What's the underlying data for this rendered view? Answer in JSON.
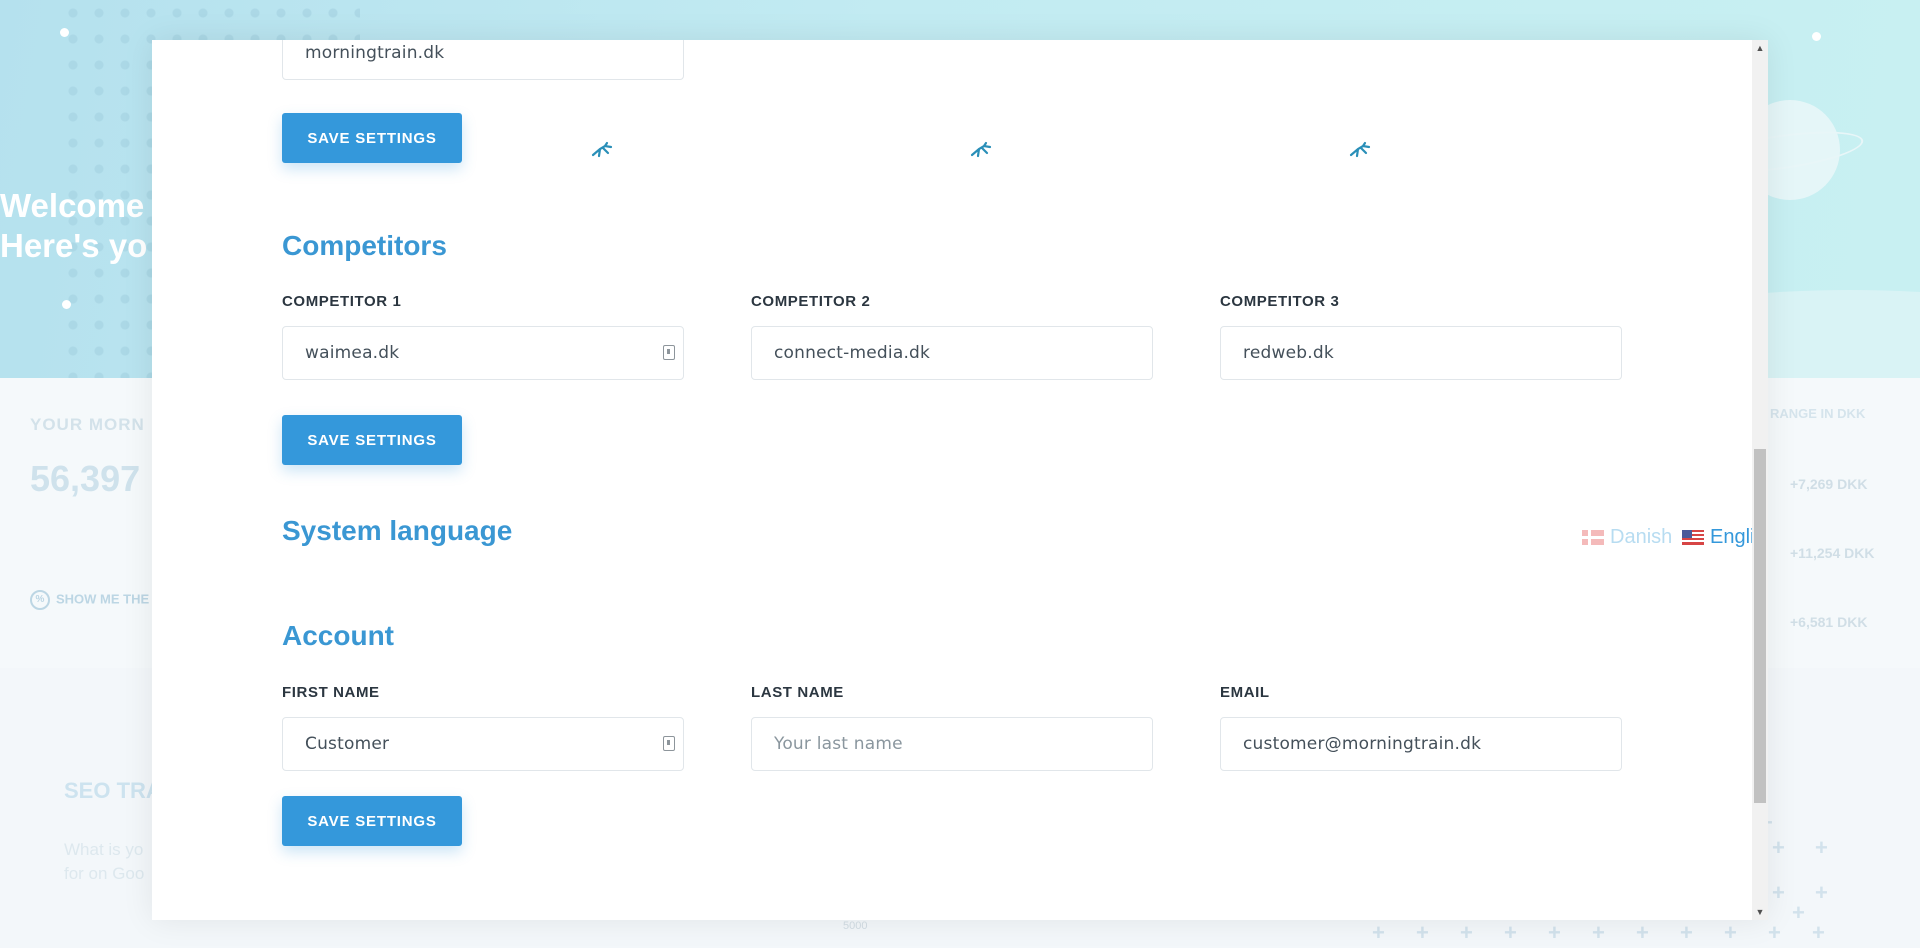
{
  "background": {
    "welcome_line1": "Welcome",
    "welcome_line2": "Here's yo",
    "stat_label": "YOUR MORN",
    "stat_value": "56,397",
    "show_me": "SHOW ME THE",
    "right_heading": "RANGE IN DKK",
    "right_values": [
      "+7,269 DKK",
      "+11,254 DKK",
      "+6,581 DKK"
    ],
    "seo_title": "SEO TRA",
    "seo_text_line1": "What is yo",
    "seo_text_line2": "for on Goo",
    "axis_tick": "5000"
  },
  "domain_section": {
    "domain_value": "morningtrain.dk",
    "save_label": "SAVE SETTINGS"
  },
  "competitors": {
    "title": "Competitors",
    "fields": [
      {
        "label": "COMPETITOR 1",
        "value": "waimea.dk"
      },
      {
        "label": "COMPETITOR 2",
        "value": "connect-media.dk"
      },
      {
        "label": "COMPETITOR 3",
        "value": "redweb.dk"
      }
    ],
    "save_label": "SAVE SETTINGS"
  },
  "system_language": {
    "title": "System language",
    "options": [
      {
        "label": "Danish",
        "active": false
      },
      {
        "label": "English",
        "active": true
      }
    ]
  },
  "account": {
    "title": "Account",
    "first_name": {
      "label": "FIRST NAME",
      "value": "Customer"
    },
    "last_name": {
      "label": "LAST NAME",
      "placeholder": "Your last name"
    },
    "email": {
      "label": "EMAIL",
      "value": "customer@morningtrain.dk"
    },
    "save_label": "SAVE SETTINGS"
  },
  "colors": {
    "accent": "#3498db",
    "title": "#3a97d3",
    "label": "#2b3640"
  },
  "scrollbar": {
    "up_icon": "triangle-up-icon",
    "down_icon": "triangle-down-icon"
  }
}
